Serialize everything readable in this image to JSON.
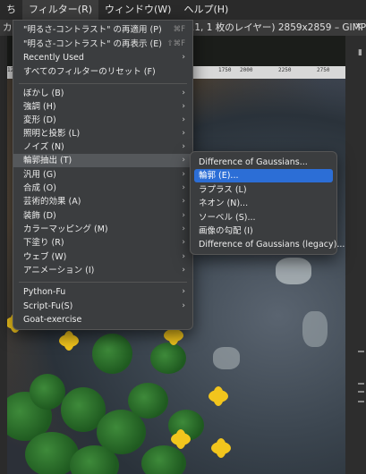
{
  "menubar": {
    "items": [
      "ち",
      "フィルター(R)",
      "ウィンドウ(W)",
      "ヘルプ(H)"
    ]
  },
  "window": {
    "title_left": "カ",
    "title": ".1, 1 枚のレイヤー) 2859x2859 – GIMP"
  },
  "ruler": {
    "ticks": [
      "1250",
      "1750",
      "2000",
      "2250",
      "2750"
    ]
  },
  "filters_menu": {
    "top_items": [
      {
        "label": "\"明るさ-コントラスト\" の再適用 (P)",
        "shortcut": "⌘F"
      },
      {
        "label": "\"明るさ-コントラスト\" の再表示 (E)",
        "shortcut": "⇧⌘F"
      },
      {
        "label": "Recently Used",
        "arrow": "›"
      },
      {
        "label": "すべてのフィルターのリセット (F)"
      }
    ],
    "groups": [
      "ぼかし (B)",
      "強調 (H)",
      "変形 (D)",
      "照明と投影 (L)",
      "ノイズ (N)",
      "輪郭抽出 (T)",
      "汎用 (G)",
      "合成 (O)",
      "芸術的効果 (A)",
      "装飾 (D)",
      "カラーマッピング (M)",
      "下塗り (R)",
      "ウェブ (W)",
      "アニメーション (I)"
    ],
    "scripts": [
      "Python-Fu",
      "Script-Fu(S)",
      "Goat-exercise"
    ],
    "arrow": "›"
  },
  "edge_submenu": {
    "items": [
      "Difference of Gaussians...",
      "輪郭 (E)...",
      "ラプラス (L)",
      "ネオン (N)...",
      "ソーベル (S)...",
      "画像の勾配 (I)",
      "Difference of Gaussians (legacy)..."
    ],
    "selected_index": 1
  },
  "colors": {
    "menu_bg": "#3b3d3f",
    "highlight": "#55585b",
    "selection": "#2c6ed6"
  }
}
